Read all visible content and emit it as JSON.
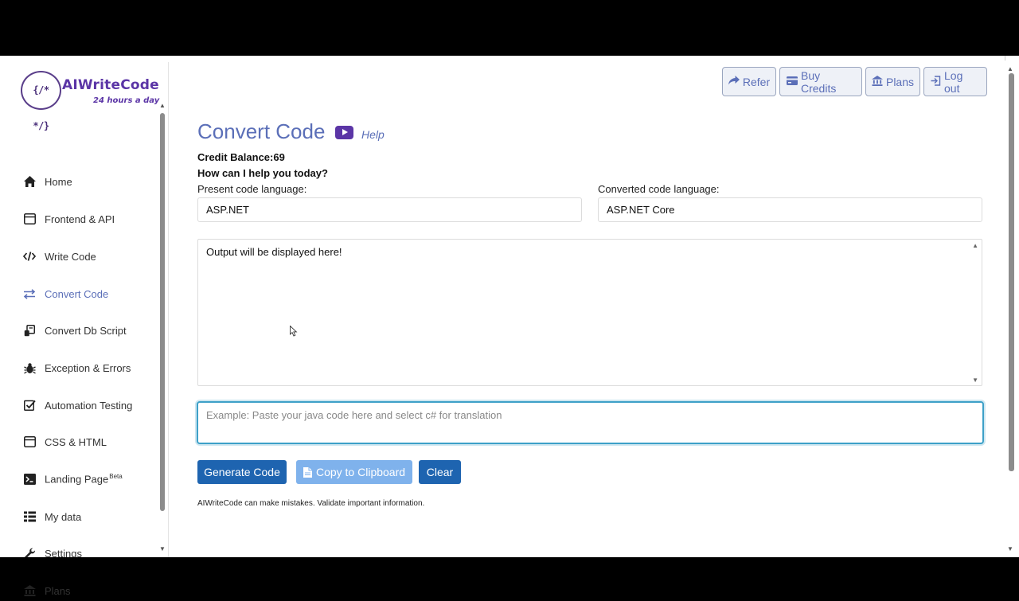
{
  "brand": {
    "logo_glyph": "{/* */}",
    "name": "AIWriteCode",
    "tagline": "24 hours a day"
  },
  "sidebar": {
    "items": [
      {
        "label": "Home",
        "icon": "home-icon"
      },
      {
        "label": "Frontend & API",
        "icon": "browser-window-icon"
      },
      {
        "label": "Write Code",
        "icon": "code-icon"
      },
      {
        "label": "Convert Code",
        "icon": "swap-arrows-icon",
        "active": true
      },
      {
        "label": "Convert Db Script",
        "icon": "db-script-icon"
      },
      {
        "label": "Exception & Errors",
        "icon": "bug-icon"
      },
      {
        "label": "Automation Testing",
        "icon": "checkbox-icon"
      },
      {
        "label": "CSS & HTML",
        "icon": "browser-window-icon"
      },
      {
        "label": "Landing Page",
        "badge": "Beta",
        "icon": "terminal-icon"
      },
      {
        "label": "My data",
        "icon": "list-icon"
      },
      {
        "label": "Settings",
        "icon": "wrench-icon"
      },
      {
        "label": "Plans",
        "icon": "bank-icon"
      }
    ]
  },
  "header": {
    "refer": "Refer",
    "buy_credits": "Buy Credits",
    "plans": "Plans",
    "logout": "Log out"
  },
  "main": {
    "title": "Convert Code",
    "help": "Help",
    "credit_balance": "Credit Balance:69",
    "prompt_question": "How can I help you today?",
    "present_label": "Present code language:",
    "present_value": "ASP.NET",
    "converted_label": "Converted code language:",
    "converted_value": "ASP.NET Core",
    "output_text": "Output will be displayed here!",
    "input_placeholder": "Example: Paste your java code here and select c# for translation",
    "generate_label": "Generate Code",
    "copy_label": "Copy to Clipboard",
    "clear_label": "Clear",
    "disclaimer": "AIWriteCode can make mistakes. Validate important information."
  },
  "colors": {
    "accent": "#5b6fb8",
    "brand": "#5b35a6",
    "primary_button": "#1e64b0",
    "disabled_button": "#7fb2ec"
  }
}
